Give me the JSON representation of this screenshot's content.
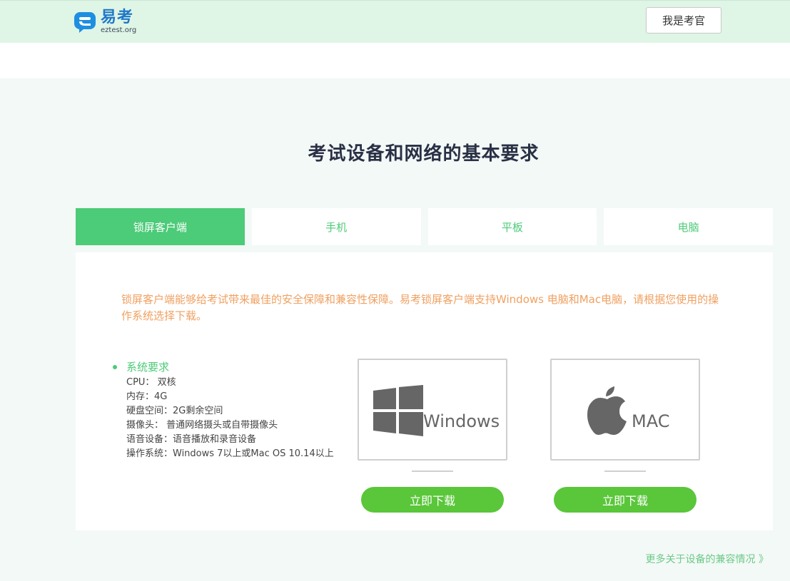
{
  "header": {
    "logo_cn": "易考",
    "logo_en": "eztest.org",
    "examiner_button": "我是考官"
  },
  "main": {
    "title": "考试设备和网络的基本要求",
    "tabs": [
      {
        "label": "锁屏客户端",
        "active": true
      },
      {
        "label": "手机",
        "active": false
      },
      {
        "label": "平板",
        "active": false
      },
      {
        "label": "电脑",
        "active": false
      }
    ],
    "description": "锁屏客户端能够给考试带来最佳的安全保障和兼容性保障。易考锁屏客户端支持Windows 电脑和Mac电脑，请根据您使用的操作系统选择下载。",
    "requirements": {
      "title": "系统要求",
      "items": [
        "CPU： 双核",
        "内存：4G",
        "硬盘空间：2G剩余空间",
        "摄像头：  普通网络摄头或自带摄像头",
        "语音设备：语音播放和录音设备",
        "操作系统：Windows 7以上或Mac OS 10.14以上"
      ]
    },
    "downloads": [
      {
        "os": "Windows",
        "icon": "windows-logo-icon",
        "button": "立即下载"
      },
      {
        "os": "MAC",
        "icon": "apple-logo-icon",
        "button": "立即下载"
      }
    ],
    "more_link": "更多关于设备的兼容情况 》"
  },
  "colors": {
    "accent_green": "#4ccb78",
    "button_green": "#5ac63a",
    "description_orange": "#f0a060",
    "header_bg": "#dff5e6"
  }
}
